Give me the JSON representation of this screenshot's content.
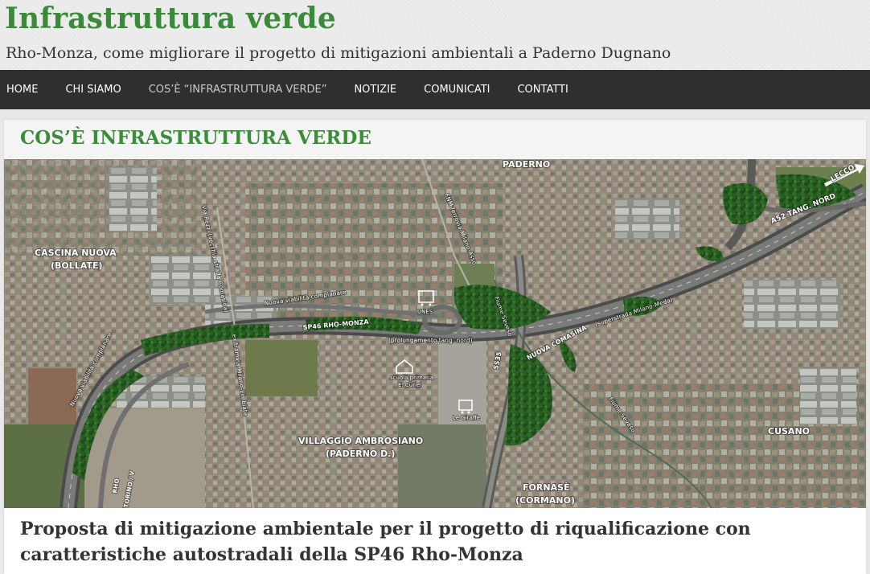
{
  "site": {
    "title": "Infrastruttura verde",
    "tagline": "Rho-Monza, come migliorare il progetto di mitigazioni ambientali a Paderno Dugnano"
  },
  "nav": {
    "items": [
      {
        "label": "HOME",
        "active": false
      },
      {
        "label": "CHI SIAMO",
        "active": false
      },
      {
        "label": "COS’È “INFRASTRUTTURA VERDE”",
        "active": true
      },
      {
        "label": "NOTIZIE",
        "active": false
      },
      {
        "label": "COMUNICATI",
        "active": false
      },
      {
        "label": "CONTATTI",
        "active": false
      }
    ]
  },
  "page": {
    "title": "COS’È INFRASTRUTTURA VERDE",
    "heading": "Proposta di mitigazione ambientale per il progetto di riqualificazione con caratteristiche autostradali della SP46 Rho-Monza"
  },
  "map": {
    "labels": {
      "paderno": "PADERNO",
      "lecco": "LECCO",
      "a52": "A52 TANG. NORD",
      "cascina_1": "CASCINA NUOVA",
      "cascina_2": "(BOLLATE)",
      "via_rezzi": "Via Rezzi (vecchia strada Comasina)",
      "fnm": "FNM ferrovia Milano-Asso",
      "nuova_viabilita_1": "Nuova viabilità complanare",
      "nuova_viabilita_2": "Nuova viabilità complanare",
      "sp46": "SP46 RHO-MONZA",
      "prolungamento": "(prolungamento tang. nord)",
      "tramvia": "ex tramvia Milano-Limbiate",
      "unes": "UNES",
      "scuola_1": "scuola primaria",
      "scuola_2": "E. Curiel",
      "giraffe": "Le Giraffe",
      "fiume_1": "Fiume Seveso",
      "fiume_2": "Fiume Seveso",
      "ss35": "SS35",
      "nuova_comasina": "NUOVA COMASINA",
      "superstrada": "(superstrada Milano-Meda)",
      "villaggio_1": "VILLAGGIO AMBROSIANO",
      "villaggio_2": "(PADERNO D.)",
      "fornase_1": "FORNASÈ",
      "fornase_2": "(CORMANO)",
      "cusano": "CUSANO",
      "rho": "RHO",
      "torino": "TORINO / V"
    }
  }
}
